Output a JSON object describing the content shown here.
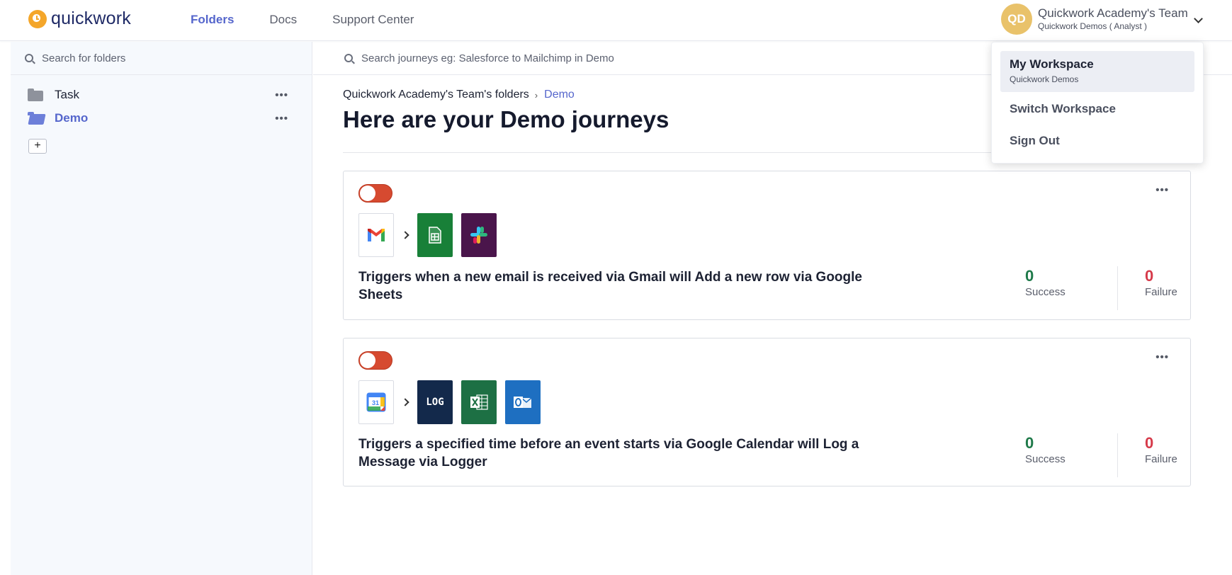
{
  "header": {
    "logo_text": "quickwork",
    "nav": [
      {
        "label": "Folders",
        "active": true
      },
      {
        "label": "Docs",
        "active": false
      },
      {
        "label": "Support Center",
        "active": false
      }
    ],
    "account": {
      "initials": "QD",
      "name": "Quickwork Academy's Team",
      "sub": "Quickwork Demos ( Analyst )"
    }
  },
  "sidebar": {
    "search_placeholder": "Search for folders",
    "folders": [
      {
        "label": "Task",
        "active": false
      },
      {
        "label": "Demo",
        "active": true
      }
    ],
    "add_label": "+"
  },
  "main": {
    "search_placeholder": "Search journeys eg: Salesforce to Mailchimp in Demo",
    "breadcrumb": {
      "root": "Quickwork Academy's Team's folders",
      "current": "Demo"
    },
    "title": "Here are your Demo journeys",
    "journeys": [
      {
        "enabled": false,
        "trigger_app": "gmail-icon",
        "action_apps": [
          "google-sheets-icon",
          "slack-icon"
        ],
        "description": "Triggers when a new email is received via Gmail will Add a new row via Google Sheets",
        "success": "0",
        "success_label": "Success",
        "failure": "0",
        "failure_label": "Failure"
      },
      {
        "enabled": false,
        "trigger_app": "google-calendar-icon",
        "action_apps": [
          "logger-icon",
          "excel-icon",
          "outlook-icon"
        ],
        "logger_text": "LOG",
        "calendar_day": "31",
        "description": "Triggers a specified time before an event starts via Google Calendar will Log a Message via Logger",
        "success": "0",
        "success_label": "Success",
        "failure": "0",
        "failure_label": "Failure"
      }
    ]
  },
  "dropdown": {
    "workspace_title": "My Workspace",
    "workspace_sub": "Quickwork Demos",
    "switch_label": "Switch Workspace",
    "signout_label": "Sign Out"
  },
  "colors": {
    "accent": "#5566cc",
    "toggle_off": "#d64a30",
    "success": "#1f7a4a",
    "failure": "#d63a4a",
    "avatar": "#e9c26a"
  }
}
